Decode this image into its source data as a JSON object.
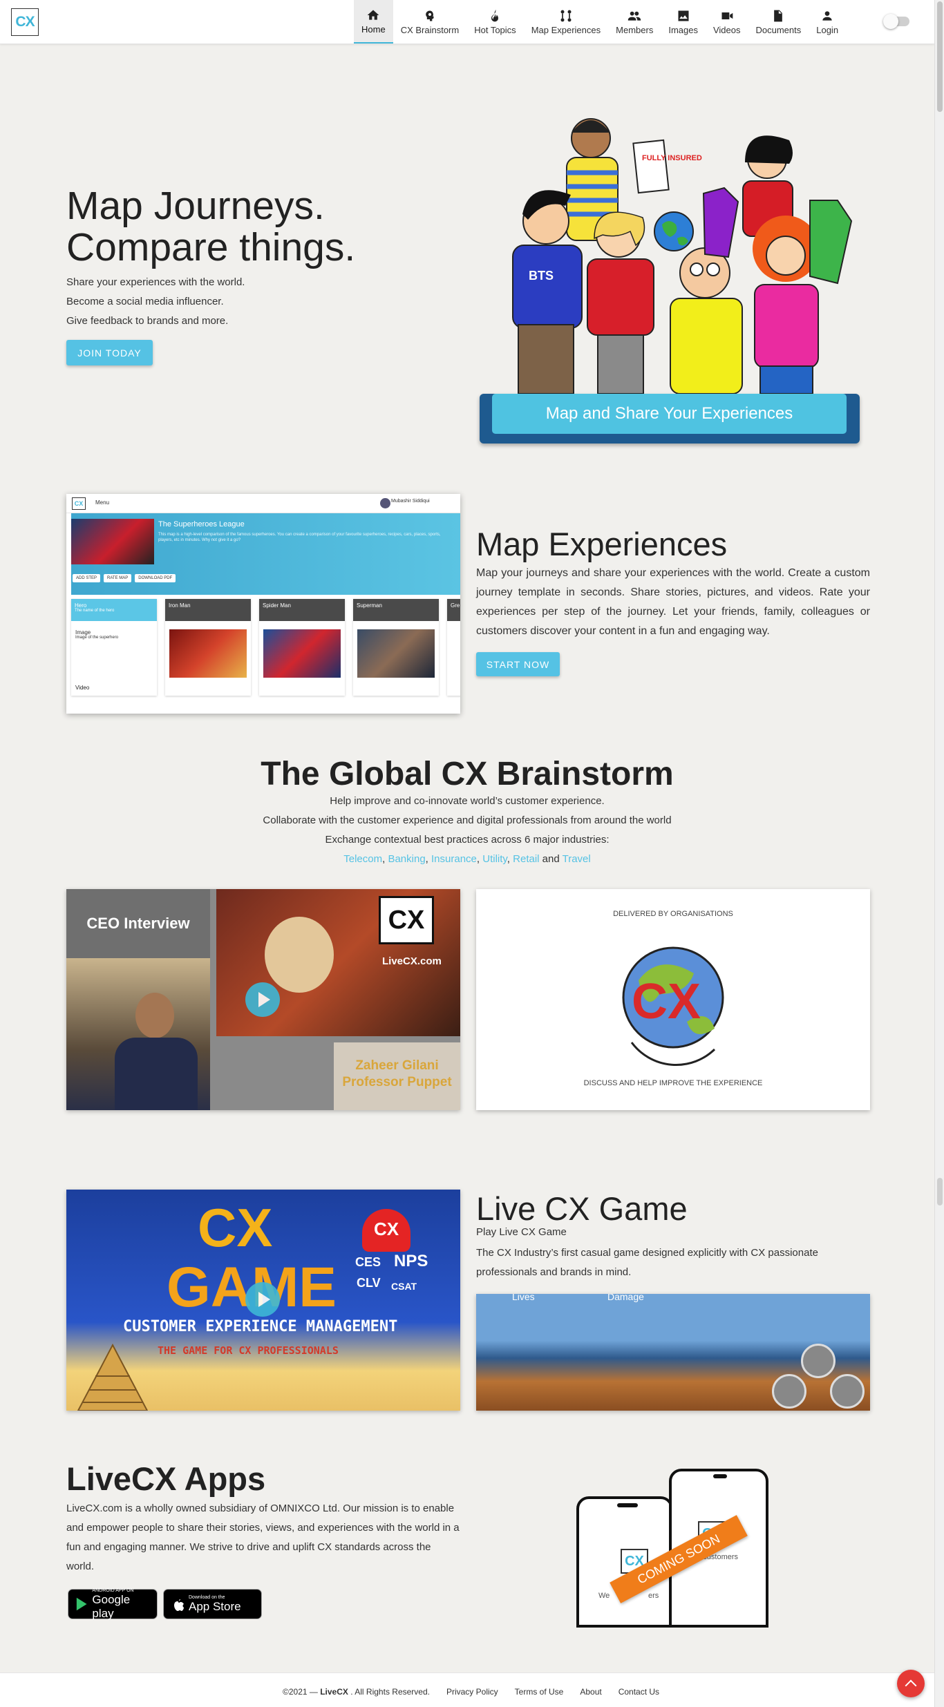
{
  "nav": {
    "logo_text": "CX",
    "items": [
      {
        "label": "Home",
        "icon": "home-icon"
      },
      {
        "label": "CX Brainstorm",
        "icon": "brain-icon"
      },
      {
        "label": "Hot Topics",
        "icon": "flame-icon"
      },
      {
        "label": "Map Experiences",
        "icon": "route-icon"
      },
      {
        "label": "Members",
        "icon": "people-icon"
      },
      {
        "label": "Images",
        "icon": "image-icon"
      },
      {
        "label": "Videos",
        "icon": "video-icon"
      },
      {
        "label": "Documents",
        "icon": "document-icon"
      },
      {
        "label": "Login",
        "icon": "person-icon"
      }
    ],
    "active": "Home",
    "theme_toggle": "off"
  },
  "hero": {
    "title_line1": "Map Journeys.",
    "title_line2": "Compare things.",
    "lines": [
      "Share your experiences with the world.",
      "Become a social media influencer.",
      "Give feedback to brands and more."
    ],
    "cta": "JOIN TODAY",
    "banner": "Map and Share Your Experiences",
    "illustration_sign": "FULLY INSURED",
    "illustration_shirt": "BTS"
  },
  "map_experiences": {
    "title": "Map Experiences",
    "text": "Map your journeys and share your experiences with the world. Create a custom journey template in seconds. Share stories, pictures, and videos. Rate your experiences per step of the journey. Let your friends, family, colleagues or customers discover your content in a fun and engaging way.",
    "cta": "START NOW",
    "screenshot": {
      "menu": "Menu",
      "user": "Mubashir Siddiqui",
      "league_title": "The Superheroes League",
      "league_desc": "This map is a high-level comparison of the famous superheroes. You can create a comparison of your favourite superheroes, recipes, cars, places, sports, players, etc in minutes. Why not give it a go?",
      "buttons": [
        "ADD STEP",
        "RATE MAP",
        "DOWNLOAD PDF"
      ],
      "first_col_head": "Hero",
      "first_col_sub": "The name of the hero",
      "first_col_row": "Image",
      "first_col_row_sub": "Image of the superhero",
      "first_col_row2": "Video",
      "columns": [
        "Iron Man",
        "Spider Man",
        "Superman",
        "Gre"
      ]
    }
  },
  "brainstorm": {
    "title": "The Global CX Brainstorm",
    "lines": [
      "Help improve and co-innovate world’s customer experience.",
      "Collaborate with the customer experience and digital professionals from around the world",
      "Exchange contextual best practices across 6 major industries:"
    ],
    "industries": [
      "Telecom",
      "Banking",
      "Insurance",
      "Utility",
      "Retail",
      "Travel"
    ],
    "conjunction": "and",
    "video_panel": {
      "ceo_label": "CEO Interview",
      "brand": "LiveCX.com",
      "logo": "CX",
      "caption": "Zaheer Gilani Professor Puppet"
    },
    "graphic_panel": {
      "top": "DELIVERED BY ORGANISATIONS",
      "bottom": "DISCUSS AND HELP IMPROVE THE EXPERIENCE",
      "logo": "CX"
    }
  },
  "game": {
    "title": "Live CX Game",
    "subtitle": "Play Live CX Game",
    "text": "The CX Industry’s first casual game designed explicitly with CX passionate professionals and brands in mind.",
    "poster": {
      "word1": "CX",
      "word2": "GAME",
      "line1": "CUSTOMER EXPERIENCE MANAGEMENT",
      "line2": "THE GAME FOR CX PROFESSIONALS",
      "hearts": [
        "CX",
        "CES",
        "NPS",
        "CLV",
        "CSAT"
      ]
    },
    "screen_labels": [
      "Lives",
      "Damage"
    ]
  },
  "apps": {
    "title": "LiveCX Apps",
    "text": "LiveCX.com is a wholly owned subsidiary of OMNIXCO Ltd. Our mission is to enable and empower people to share their stories, views, and experiences with the world in a fun and engaging manner. We strive to drive and uplift CX standards across the world.",
    "google_small": "ANDROID APP ON",
    "google_big": "Google play",
    "apple_small": "Download on the",
    "apple_big": "App Store",
    "phone_ribbon": "COMING SOON",
    "phone_text_left": "We",
    "phone_text_left2": "ers",
    "phone_text_right": "ad customers",
    "phone_logo": "CX"
  },
  "footer": {
    "copyright": "©2021 —",
    "brand": "LiveCX",
    "rights": ". All Rights Reserved.",
    "links": [
      "Privacy Policy",
      "Terms of Use",
      "About",
      "Contact Us"
    ]
  },
  "colors": {
    "accent": "#55c2e4",
    "banner_dark": "#1e5a8f",
    "background": "#f1f0ed",
    "fab": "#e53935"
  }
}
